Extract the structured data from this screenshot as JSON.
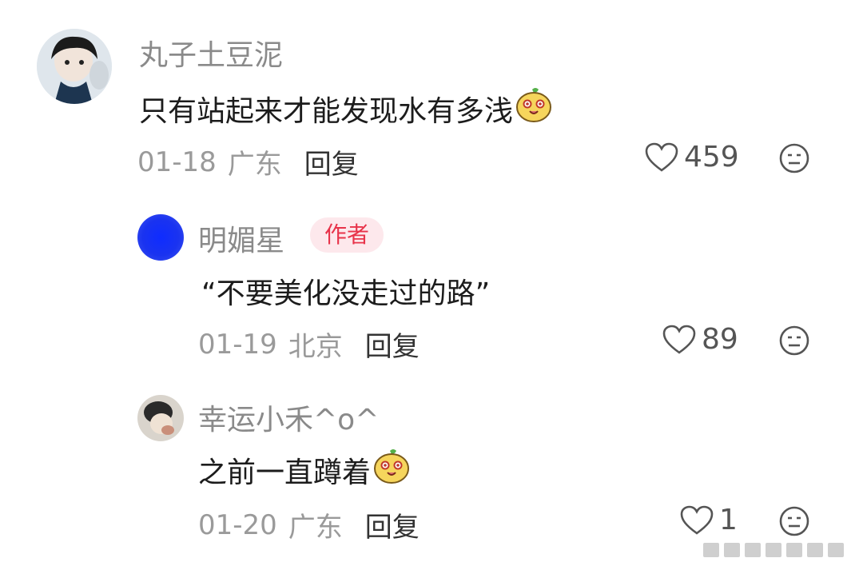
{
  "comments": [
    {
      "username": "丸子土豆泥",
      "text": "只有站起来才能发现水有多浅",
      "date": "01-18",
      "location": "广东",
      "reply_label": "回复",
      "likes": "459",
      "is_author": false,
      "avatar_icon": "user-photo-avatar",
      "emoji_icon": "potato-face-emoji"
    },
    {
      "username": "明媚星",
      "author_badge": "作者",
      "text": "“不要美化没走过的路”",
      "date": "01-19",
      "location": "北京",
      "reply_label": "回复",
      "likes": "89",
      "is_author": true,
      "avatar_color": "#1a33f0"
    },
    {
      "username": "幸运小禾^o^",
      "text": "之前一直蹲着",
      "date": "01-20",
      "location": "广东",
      "reply_label": "回复",
      "likes": "1",
      "is_author": false,
      "avatar_icon": "user-photo-avatar",
      "emoji_icon": "potato-face-emoji"
    }
  ],
  "colors": {
    "name": "#8a8a8a",
    "meta": "#9a9a9a",
    "badge_bg": "#fde8ec",
    "badge_text": "#e8334a"
  }
}
